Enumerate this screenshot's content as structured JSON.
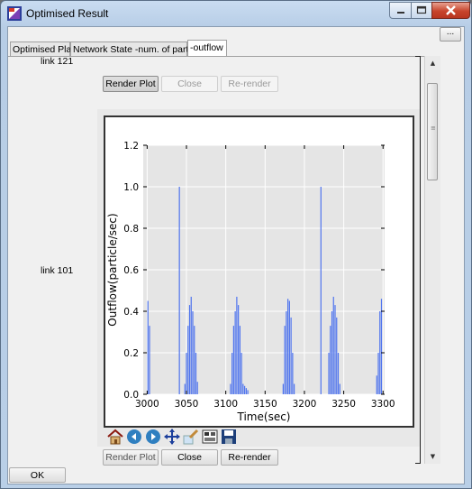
{
  "window": {
    "title": "Optimised Result",
    "accent_color": "#b9cfe7",
    "close_color": "#c7442c"
  },
  "top_right_button": {
    "label": "..."
  },
  "tabs": [
    {
      "label": "Optimised Plan",
      "active": false
    },
    {
      "label": "Network State -num. of particle",
      "active": false
    },
    {
      "label": "-outflow",
      "active": true
    }
  ],
  "rows": [
    {
      "label": "link 121"
    },
    {
      "label": "link 101"
    }
  ],
  "plot_buttons_top": {
    "render": "Render Plot",
    "close": "Close",
    "rerender": "Re-render"
  },
  "plot_buttons_bottom": {
    "render": "Render Plot",
    "close": "Close",
    "rerender": "Re-render"
  },
  "toolbar_icons": [
    "home-icon",
    "back-icon",
    "forward-icon",
    "pan-icon",
    "zoom-icon",
    "subplot-config-icon",
    "save-icon"
  ],
  "ok_button": {
    "label": "OK"
  },
  "chart_data": {
    "type": "bar",
    "xlabel": "Time(sec)",
    "ylabel": "Outflow(particle/sec)",
    "xlim": [
      2995,
      3302
    ],
    "ylim": [
      0,
      1.2
    ],
    "xticks": [
      "3000",
      "3050",
      "3100",
      "3150",
      "3200",
      "3250",
      "3300"
    ],
    "yticks": [
      "0.0",
      "0.2",
      "0.4",
      "0.6",
      "0.8",
      "1.0",
      "1.2"
    ],
    "grid": true,
    "bar_color": "#4f74ee",
    "x": [
      3001,
      3003,
      3041,
      3048,
      3050,
      3052,
      3054,
      3056,
      3058,
      3060,
      3062,
      3064,
      3106,
      3108,
      3110,
      3112,
      3114,
      3116,
      3118,
      3120,
      3122,
      3124,
      3126,
      3128,
      3173,
      3175,
      3177,
      3179,
      3181,
      3183,
      3185,
      3187,
      3221,
      3231,
      3233,
      3235,
      3237,
      3239,
      3241,
      3243,
      3245,
      3292,
      3294,
      3296,
      3298
    ],
    "values": [
      0.45,
      0.33,
      1.0,
      0.05,
      0.2,
      0.33,
      0.43,
      0.47,
      0.4,
      0.33,
      0.2,
      0.06,
      0.05,
      0.2,
      0.33,
      0.4,
      0.47,
      0.43,
      0.33,
      0.2,
      0.05,
      0.04,
      0.03,
      0.02,
      0.05,
      0.33,
      0.4,
      0.46,
      0.45,
      0.37,
      0.2,
      0.05,
      1.0,
      0.2,
      0.33,
      0.4,
      0.47,
      0.43,
      0.37,
      0.2,
      0.05,
      0.09,
      0.2,
      0.4,
      0.46
    ]
  }
}
